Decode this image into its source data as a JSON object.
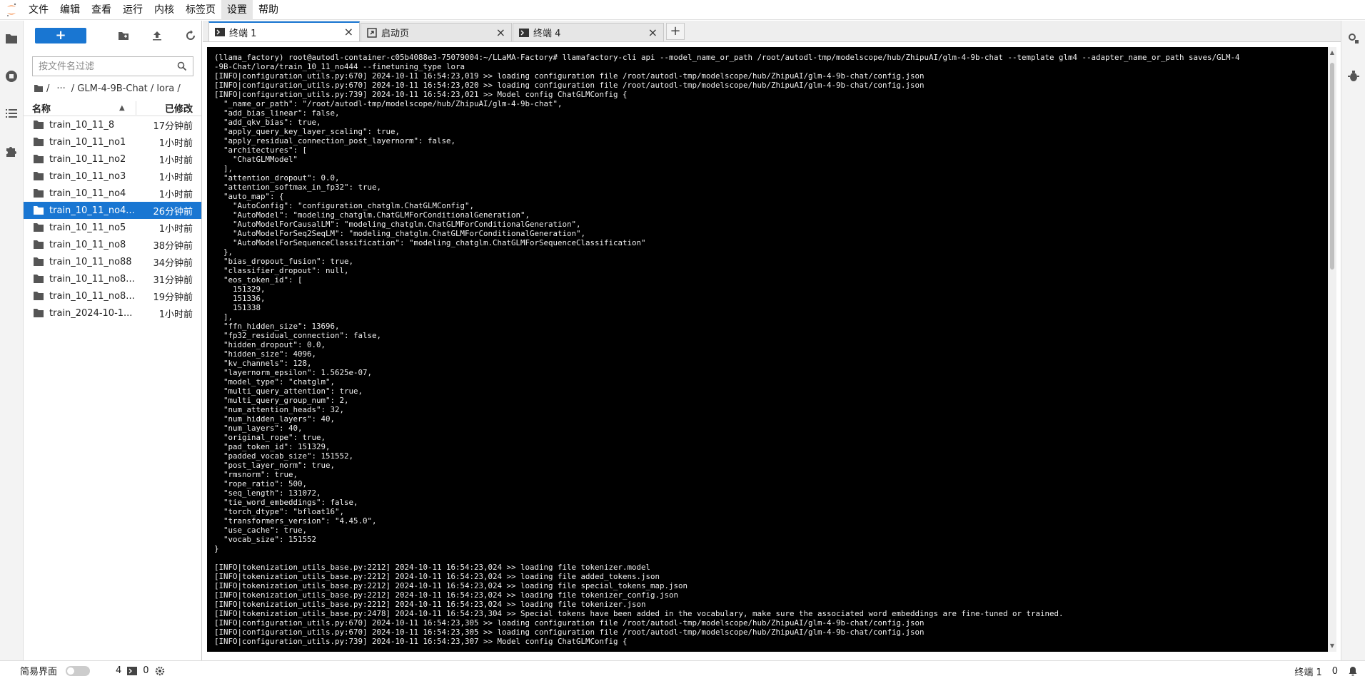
{
  "menubar": {
    "items": [
      "文件",
      "编辑",
      "查看",
      "运行",
      "内核",
      "标签页",
      "设置",
      "帮助"
    ],
    "active_index": 6
  },
  "filebrowser": {
    "filter_placeholder": "按文件名过滤",
    "breadcrumb": {
      "root": "/",
      "ellipsis": "···",
      "path": "/ GLM-4-9B-Chat / lora /"
    },
    "columns": {
      "name": "名称",
      "modified": "已修改"
    },
    "rows": [
      {
        "name": "train_10_11_8",
        "modified": "17分钟前"
      },
      {
        "name": "train_10_11_no1",
        "modified": "1小时前"
      },
      {
        "name": "train_10_11_no2",
        "modified": "1小时前"
      },
      {
        "name": "train_10_11_no3",
        "modified": "1小时前"
      },
      {
        "name": "train_10_11_no4",
        "modified": "1小时前"
      },
      {
        "name": "train_10_11_no4...",
        "modified": "26分钟前",
        "selected": true
      },
      {
        "name": "train_10_11_no5",
        "modified": "1小时前"
      },
      {
        "name": "train_10_11_no8",
        "modified": "38分钟前"
      },
      {
        "name": "train_10_11_no88",
        "modified": "34分钟前"
      },
      {
        "name": "train_10_11_no8...",
        "modified": "31分钟前"
      },
      {
        "name": "train_10_11_no8...",
        "modified": "19分钟前"
      },
      {
        "name": "train_2024-10-1...",
        "modified": "1小时前"
      }
    ]
  },
  "tabs": [
    {
      "label": "终端 1",
      "icon": "terminal-icon",
      "active": true
    },
    {
      "label": "启动页",
      "icon": "launcher-icon",
      "active": false
    },
    {
      "label": "终端 4",
      "icon": "terminal-icon",
      "active": false
    }
  ],
  "tab_add_label": "+",
  "tab_close_glyph": "×",
  "terminal": {
    "lines": [
      "(llama_factory) root@autodl-container-c05b4088e3-75079004:~/LLaMA-Factory# llamafactory-cli api --model_name_or_path /root/autodl-tmp/modelscope/hub/ZhipuAI/glm-4-9b-chat --template glm4 --adapter_name_or_path saves/GLM-4",
      "-9B-Chat/lora/train_10_11_no444 --finetuning_type lora",
      "[INFO|configuration_utils.py:670] 2024-10-11 16:54:23,019 >> loading configuration file /root/autodl-tmp/modelscope/hub/ZhipuAI/glm-4-9b-chat/config.json",
      "[INFO|configuration_utils.py:670] 2024-10-11 16:54:23,020 >> loading configuration file /root/autodl-tmp/modelscope/hub/ZhipuAI/glm-4-9b-chat/config.json",
      "[INFO|configuration_utils.py:739] 2024-10-11 16:54:23,021 >> Model config ChatGLMConfig {",
      "  \"_name_or_path\": \"/root/autodl-tmp/modelscope/hub/ZhipuAI/glm-4-9b-chat\",",
      "  \"add_bias_linear\": false,",
      "  \"add_qkv_bias\": true,",
      "  \"apply_query_key_layer_scaling\": true,",
      "  \"apply_residual_connection_post_layernorm\": false,",
      "  \"architectures\": [",
      "    \"ChatGLMModel\"",
      "  ],",
      "  \"attention_dropout\": 0.0,",
      "  \"attention_softmax_in_fp32\": true,",
      "  \"auto_map\": {",
      "    \"AutoConfig\": \"configuration_chatglm.ChatGLMConfig\",",
      "    \"AutoModel\": \"modeling_chatglm.ChatGLMForConditionalGeneration\",",
      "    \"AutoModelForCausalLM\": \"modeling_chatglm.ChatGLMForConditionalGeneration\",",
      "    \"AutoModelForSeq2SeqLM\": \"modeling_chatglm.ChatGLMForConditionalGeneration\",",
      "    \"AutoModelForSequenceClassification\": \"modeling_chatglm.ChatGLMForSequenceClassification\"",
      "  },",
      "  \"bias_dropout_fusion\": true,",
      "  \"classifier_dropout\": null,",
      "  \"eos_token_id\": [",
      "    151329,",
      "    151336,",
      "    151338",
      "  ],",
      "  \"ffn_hidden_size\": 13696,",
      "  \"fp32_residual_connection\": false,",
      "  \"hidden_dropout\": 0.0,",
      "  \"hidden_size\": 4096,",
      "  \"kv_channels\": 128,",
      "  \"layernorm_epsilon\": 1.5625e-07,",
      "  \"model_type\": \"chatglm\",",
      "  \"multi_query_attention\": true,",
      "  \"multi_query_group_num\": 2,",
      "  \"num_attention_heads\": 32,",
      "  \"num_hidden_layers\": 40,",
      "  \"num_layers\": 40,",
      "  \"original_rope\": true,",
      "  \"pad_token_id\": 151329,",
      "  \"padded_vocab_size\": 151552,",
      "  \"post_layer_norm\": true,",
      "  \"rmsnorm\": true,",
      "  \"rope_ratio\": 500,",
      "  \"seq_length\": 131072,",
      "  \"tie_word_embeddings\": false,",
      "  \"torch_dtype\": \"bfloat16\",",
      "  \"transformers_version\": \"4.45.0\",",
      "  \"use_cache\": true,",
      "  \"vocab_size\": 151552",
      "}",
      "",
      "[INFO|tokenization_utils_base.py:2212] 2024-10-11 16:54:23,024 >> loading file tokenizer.model",
      "[INFO|tokenization_utils_base.py:2212] 2024-10-11 16:54:23,024 >> loading file added_tokens.json",
      "[INFO|tokenization_utils_base.py:2212] 2024-10-11 16:54:23,024 >> loading file special_tokens_map.json",
      "[INFO|tokenization_utils_base.py:2212] 2024-10-11 16:54:23,024 >> loading file tokenizer_config.json",
      "[INFO|tokenization_utils_base.py:2212] 2024-10-11 16:54:23,024 >> loading file tokenizer.json",
      "[INFO|tokenization_utils_base.py:2478] 2024-10-11 16:54:23,304 >> Special tokens have been added in the vocabulary, make sure the associated word embeddings are fine-tuned or trained.",
      "[INFO|configuration_utils.py:670] 2024-10-11 16:54:23,305 >> loading configuration file /root/autodl-tmp/modelscope/hub/ZhipuAI/glm-4-9b-chat/config.json",
      "[INFO|configuration_utils.py:670] 2024-10-11 16:54:23,305 >> loading configuration file /root/autodl-tmp/modelscope/hub/ZhipuAI/glm-4-9b-chat/config.json",
      "[INFO|configuration_utils.py:739] 2024-10-11 16:54:23,307 >> Model config ChatGLMConfig {"
    ]
  },
  "statusbar": {
    "simple_mode_label": "简易界面",
    "kernel_count": "4",
    "terminal_count": "0",
    "current_tab": "终端 1",
    "notification_count": "0"
  },
  "colors": {
    "accent": "#1976d2",
    "terminal_bg": "#000000",
    "terminal_fg": "#f0f0f0",
    "logo": "#f37726"
  }
}
